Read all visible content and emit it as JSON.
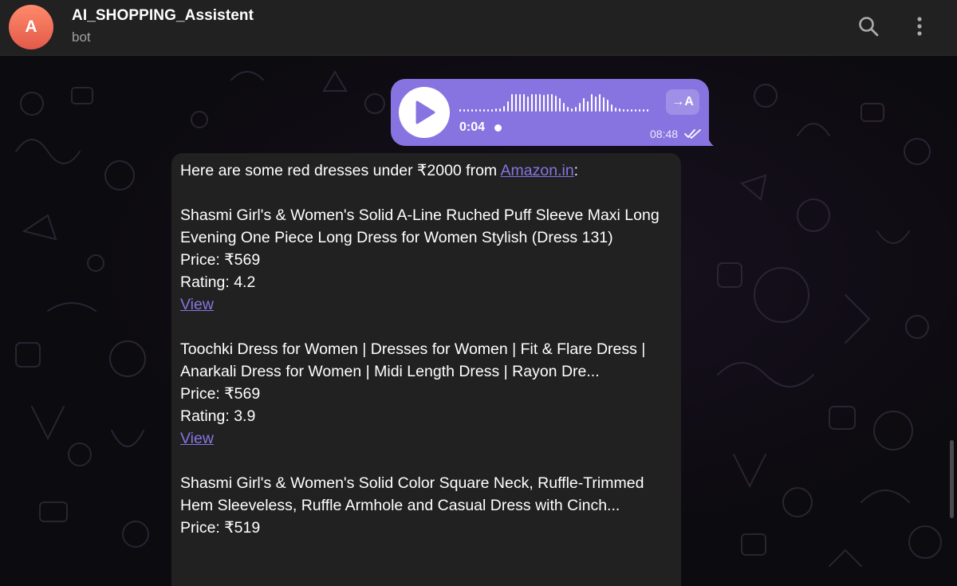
{
  "header": {
    "avatar_letter": "A",
    "title": "AI_SHOPPING_Assistent",
    "subtitle": "bot",
    "search_icon": "search-icon",
    "menu_icon": "more-vertical-icon"
  },
  "voice_message": {
    "duration": "0:04",
    "time": "08:48",
    "transcribe_label": "→A",
    "status": "read",
    "bubble_color": "#8774e1"
  },
  "bot_message": {
    "intro_text": "Here are some red dresses under ₹2000 from ",
    "intro_link": "Amazon.in",
    "intro_suffix": ":",
    "products": [
      {
        "name": "Shasmi Girl's & Women's Solid A-Line Ruched Puff Sleeve Maxi Long Evening One Piece Long Dress for Women Stylish (Dress 131)",
        "price": "Price: ₹569",
        "rating": "Rating: 4.2",
        "link": "View"
      },
      {
        "name": "Toochki Dress for Women | Dresses for Women | Fit & Flare Dress | Anarkali Dress for Women | Midi Length Dress | Rayon Dre...",
        "price": "Price: ₹569",
        "rating": "Rating: 3.9",
        "link": "View"
      },
      {
        "name": "Shasmi Girl's & Women's Solid Color Square Neck, Ruffle-Trimmed Hem Sleeveless, Ruffle Armhole and Casual Dress with Cinch...",
        "price": "Price: ₹519"
      }
    ]
  },
  "colors": {
    "accent": "#8774e1",
    "header_bg": "#212121",
    "bubble_bg": "#212121"
  }
}
